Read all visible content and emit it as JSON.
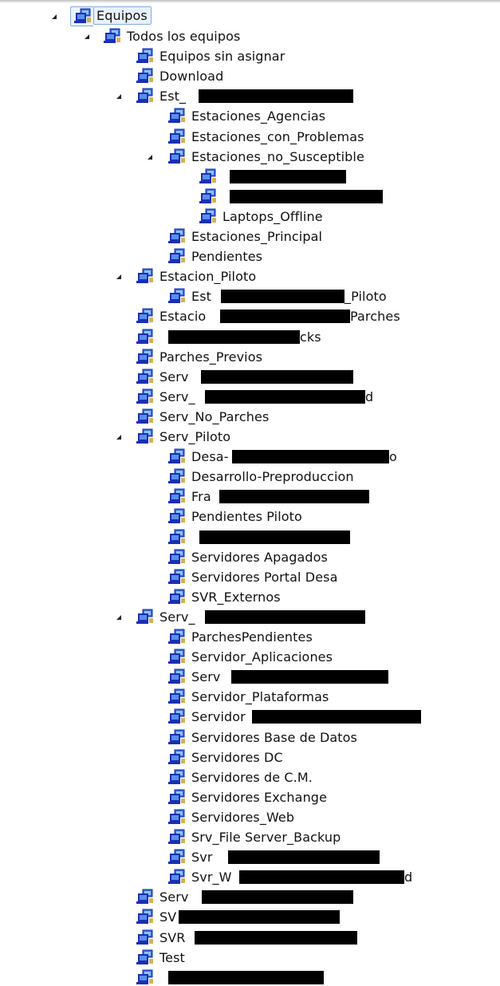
{
  "tree": {
    "root": {
      "label": "Equipos",
      "icon": "computers-group-icon",
      "expanded": true,
      "selected": true
    },
    "items": [
      {
        "label": "Todos los equipos",
        "level": 1,
        "expanded": true
      },
      {
        "label": "Equipos sin asignar",
        "level": 2
      },
      {
        "label": "Download",
        "level": 2
      },
      {
        "label": "Est_",
        "level": 2,
        "expanded": true,
        "redacted": true
      },
      {
        "label": "Estaciones_Agencias",
        "level": 3
      },
      {
        "label": "Estaciones_con_Problemas",
        "level": 3
      },
      {
        "label": "Estaciones_no_Susceptible",
        "level": 3,
        "expanded": true
      },
      {
        "label": "",
        "level": 4,
        "redacted": true
      },
      {
        "label": "",
        "level": 4,
        "redacted": true
      },
      {
        "label": "Laptops_Offline",
        "level": 4
      },
      {
        "label": "Estaciones_Principal",
        "level": 3
      },
      {
        "label": "Pendientes",
        "level": 3
      },
      {
        "label": "Estacion_Piloto",
        "level": 2,
        "expanded": true
      },
      {
        "label": "Est",
        "suffix": "_Piloto",
        "level": 3,
        "redacted": true
      },
      {
        "label": "Estacio",
        "suffix": "Parches",
        "level": 2,
        "redacted": true
      },
      {
        "label": "",
        "suffix": "cks",
        "level": 2,
        "redacted": true
      },
      {
        "label": "Parches_Previos",
        "level": 2
      },
      {
        "label": "Serv",
        "level": 2,
        "redacted": true
      },
      {
        "label": "Serv_",
        "suffix": "d",
        "level": 2,
        "redacted": true
      },
      {
        "label": "Serv_No_Parches",
        "level": 2
      },
      {
        "label": "Serv_Piloto",
        "level": 2,
        "expanded": true
      },
      {
        "label": "Desa-",
        "suffix": "o",
        "level": 3,
        "redacted": true
      },
      {
        "label": "Desarrollo-Preproduccion",
        "level": 3
      },
      {
        "label": "Fra",
        "level": 3,
        "redacted": true
      },
      {
        "label": "Pendientes Piloto",
        "level": 3
      },
      {
        "label": "",
        "level": 3,
        "redacted": true
      },
      {
        "label": "Servidores Apagados",
        "level": 3
      },
      {
        "label": "Servidores Portal Desa",
        "level": 3
      },
      {
        "label": "SVR_Externos",
        "level": 3
      },
      {
        "label": "Serv_",
        "level": 2,
        "expanded": true,
        "redacted": true
      },
      {
        "label": "ParchesPendientes",
        "level": 3
      },
      {
        "label": "Servidor_Aplicaciones",
        "level": 3
      },
      {
        "label": "Serv",
        "level": 3,
        "redacted": true
      },
      {
        "label": "Servidor_Plataformas",
        "level": 3
      },
      {
        "label": "Servidor",
        "level": 3,
        "redacted": true
      },
      {
        "label": "Servidores Base de Datos",
        "level": 3
      },
      {
        "label": "Servidores DC",
        "level": 3
      },
      {
        "label": "Servidores de C.M.",
        "level": 3
      },
      {
        "label": "Servidores Exchange",
        "level": 3
      },
      {
        "label": "Servidores_Web",
        "level": 3
      },
      {
        "label": "Srv_File Server_Backup",
        "level": 3
      },
      {
        "label": "Svr",
        "level": 3,
        "redacted": true
      },
      {
        "label": "Svr_W",
        "suffix": "d",
        "level": 3,
        "redacted": true
      },
      {
        "label": "Serv",
        "level": 2,
        "redacted": true
      },
      {
        "label": "SV",
        "level": 2,
        "redacted": true
      },
      {
        "label": "SVR",
        "level": 2,
        "redacted": true
      },
      {
        "label": "Test",
        "level": 2
      },
      {
        "label": "",
        "level": 2,
        "redacted": true
      }
    ]
  },
  "colors": {
    "icon_dark": "#1b2fb0",
    "icon_light": "#2f6bd8",
    "icon_accent": "#c9a53a",
    "selection_bg": "#e9f1fb",
    "selection_border": "#84acdd",
    "redaction": "#000000"
  }
}
